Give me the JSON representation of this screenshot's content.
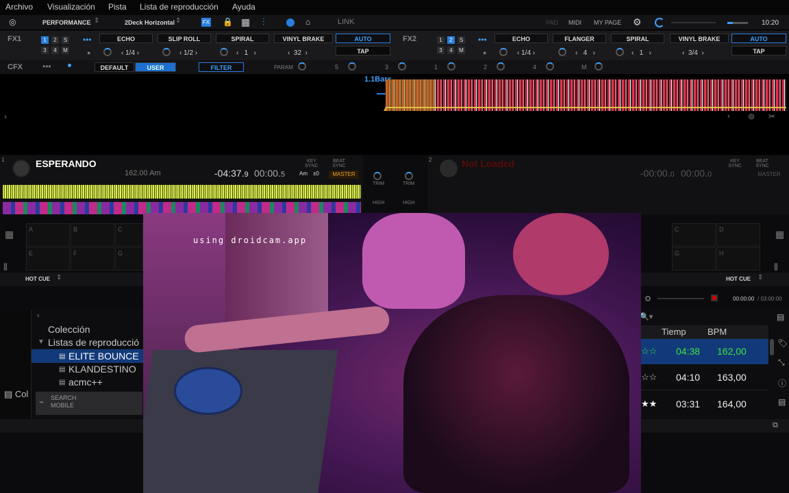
{
  "menu": [
    "Archivo",
    "Visualización",
    "Pista",
    "Lista de reproducción",
    "Ayuda"
  ],
  "toolbar": {
    "mode": "PERFORMANCE",
    "layout": "2Deck Horizontal",
    "link": "LINK",
    "pad": "PAD",
    "midi": "MIDI",
    "my_page": "MY PAGE",
    "clock": "10:20"
  },
  "fx1": {
    "label": "FX1",
    "beat_nums": [
      "1",
      "2",
      "S",
      "3",
      "4",
      "M"
    ],
    "effects": [
      "ECHO",
      "SLIP ROLL",
      "SPIRAL",
      "VINYL BRAKE"
    ],
    "values": [
      "1/4",
      "1/2",
      "1",
      "32"
    ],
    "auto": "AUTO",
    "tap": "TAP"
  },
  "fx2": {
    "label": "FX2",
    "beat_nums": [
      "1",
      "2",
      "S",
      "3",
      "4",
      "M"
    ],
    "effects": [
      "ECHO",
      "FLANGER",
      "SPIRAL",
      "VINYL BRAKE"
    ],
    "values": [
      "1/4",
      "4",
      "1",
      "3/4"
    ],
    "auto": "AUTO",
    "tap": "TAP"
  },
  "cfx": {
    "label": "CFX",
    "default": "DEFAULT",
    "user": "USER",
    "filter": "FILTER",
    "param": "PARAM",
    "scale": [
      "5",
      "3",
      "1",
      "2",
      "4",
      "M"
    ]
  },
  "overview": {
    "bars": "1.1Bars"
  },
  "deck1": {
    "num": "1",
    "title": "ESPERANDO",
    "bpm": "162.00 Am",
    "remain_main": "-04:37.",
    "remain_frac": "9",
    "elapsed_main": "00:00.",
    "elapsed_frac": "5",
    "key_sync": "KEY SYNC",
    "beat_sync": "BEAT SYNC",
    "key": "Am",
    "pitch": "±0",
    "master": "MASTER",
    "hot_cue": "HOT CUE",
    "pads": [
      "A",
      "B",
      "C",
      "E",
      "F",
      "G"
    ]
  },
  "deck2": {
    "num": "2",
    "title": "Not Loaded",
    "remain_main": "-00:00.",
    "remain_frac": "0",
    "elapsed_main": "00:00.",
    "elapsed_frac": "0",
    "key_sync": "KEY SYNC",
    "beat_sync": "BEAT SYNC",
    "master": "MASTER",
    "hot_cue": "HOT CUE",
    "pads": [
      "C",
      "D",
      "G",
      "H"
    ],
    "rec_time": "00:00:00",
    "rec_total": "03:00:00"
  },
  "mixer": {
    "trim": "TRIM",
    "high": "HIGH"
  },
  "browser": {
    "tree": [
      {
        "label": "Colección"
      },
      {
        "label": "Listas de reproducció"
      },
      {
        "label": "ELITE BOUNCE"
      },
      {
        "label": "KLANDESTINO"
      },
      {
        "label": "acmc++"
      }
    ],
    "col_short": "Col",
    "search_mobile": "SEARCH MOBILE",
    "columns": {
      "time": "Tiemp",
      "bpm": "BPM"
    },
    "rows": [
      {
        "time": "04:38",
        "bpm": "162,00"
      },
      {
        "time": "04:10",
        "bpm": "163,00"
      },
      {
        "time": "03:31",
        "bpm": "164,00"
      }
    ]
  },
  "camera": {
    "watermark": "using droidcam.app"
  },
  "colors": {
    "accent": "#2a7ee0",
    "master": "#e0a030",
    "selected_row": "#123a7a",
    "green_time": "#3ee43e"
  }
}
